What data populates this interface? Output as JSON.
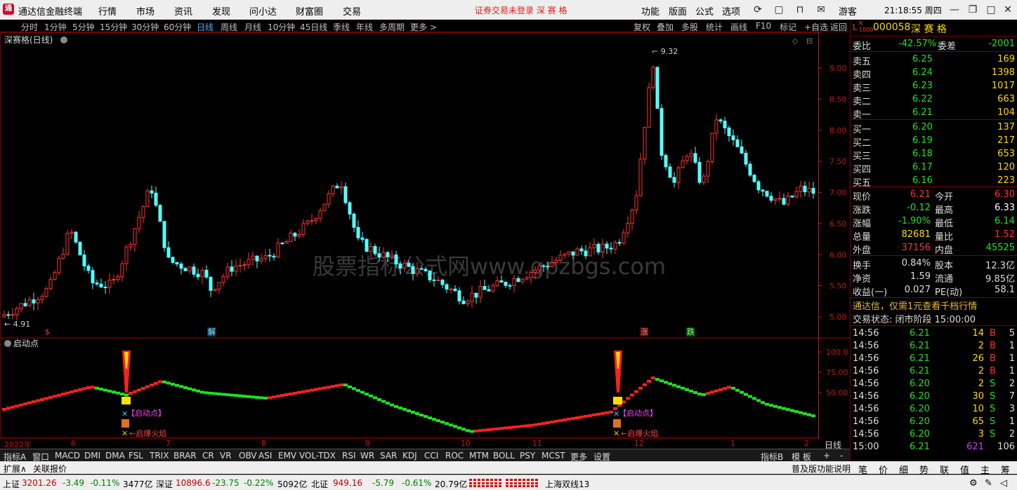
{
  "app": {
    "name": "通达信金融终端",
    "menu": [
      "行情",
      "市场",
      "资讯",
      "发现",
      "问小达",
      "财富圈",
      "交易"
    ],
    "notice": "证券交易未登录  深 赛 格",
    "right_menu": [
      "功能",
      "版面",
      "公式",
      "选项"
    ],
    "user": "游客",
    "clock": "21:18:55 周四"
  },
  "periods": [
    "分时",
    "1分钟",
    "5分钟",
    "15分钟",
    "30分钟",
    "60分钟",
    "日线",
    "周线",
    "月线",
    "10分钟",
    "45日线",
    "季线",
    "年线",
    "多周期",
    "更多 >"
  ],
  "active_period": "日线",
  "tools": [
    "复权",
    "叠加",
    "多股",
    "统计",
    "画线",
    "F10",
    "标记",
    "+自选",
    "返回"
  ],
  "chart": {
    "title": "深赛格(日线)",
    "price_labels": [
      "9.00",
      "8.50",
      "8.00",
      "7.50",
      "7.00",
      "6.50",
      "6.00",
      "5.50",
      "5.00"
    ],
    "high_marker": "9.32",
    "low_marker": "4.91",
    "watermark": "股票指标公式网www.gpzbgs.com",
    "event_tags": [
      "$",
      "解",
      "涨",
      "跌"
    ],
    "colors": {
      "up": "#ff3232",
      "down": "#54ffff",
      "axis": "#c01818"
    }
  },
  "indicator": {
    "title": "启动点",
    "levels": [
      "100.0",
      "75.00",
      "50.00"
    ],
    "signal_label": "【启动点】",
    "fire_label": "启爆火焰",
    "colors": {
      "up": "#ff2020",
      "down": "#20e020",
      "label": "#ff40ff"
    }
  },
  "xaxis": {
    "labels": [
      "2022年",
      "6",
      "7",
      "8",
      "9",
      "10",
      "11",
      "12",
      "1",
      "2"
    ],
    "period": "日线"
  },
  "quote": {
    "code": "000058",
    "name": "深 赛 格",
    "weibi_label": "委比",
    "weibi": "-42.57%",
    "weicha_label": "委差",
    "weicha": "-2001",
    "sells": [
      {
        "label": "卖五",
        "price": "6.25",
        "vol": "169"
      },
      {
        "label": "卖四",
        "price": "6.24",
        "vol": "1398"
      },
      {
        "label": "卖三",
        "price": "6.23",
        "vol": "1017"
      },
      {
        "label": "卖二",
        "price": "6.22",
        "vol": "663"
      },
      {
        "label": "卖一",
        "price": "6.21",
        "vol": "104"
      }
    ],
    "buys": [
      {
        "label": "买一",
        "price": "6.20",
        "vol": "137"
      },
      {
        "label": "买二",
        "price": "6.19",
        "vol": "217"
      },
      {
        "label": "买三",
        "price": "6.18",
        "vol": "653"
      },
      {
        "label": "买四",
        "price": "6.17",
        "vol": "120"
      },
      {
        "label": "买五",
        "price": "6.16",
        "vol": "223"
      }
    ],
    "stats": [
      {
        "l1": "现价",
        "v1": "6.21",
        "l2": "今开",
        "v2": "6.30"
      },
      {
        "l1": "涨跌",
        "v1": "-0.12",
        "l2": "最高",
        "v2": "6.33"
      },
      {
        "l1": "涨幅",
        "v1": "-1.90%",
        "l2": "最低",
        "v2": "6.14"
      },
      {
        "l1": "总量",
        "v1": "82681",
        "l2": "量比",
        "v2": "1.52"
      },
      {
        "l1": "外盘",
        "v1": "37156",
        "l2": "内盘",
        "v2": "45525"
      }
    ],
    "fund": [
      {
        "l1": "换手",
        "v1": "0.84%",
        "l2": "股本",
        "v2": "12.3亿"
      },
      {
        "l1": "净资",
        "v1": "1.59",
        "l2": "流通",
        "v2": "9.85亿"
      },
      {
        "l1": "收益(一)",
        "v1": "0.027",
        "l2": "PE(动)",
        "v2": "58.1"
      }
    ],
    "promo": "通达信，仅需1元查看千档行情",
    "trade_status": "交易状态: 闭市阶段 15:00:00",
    "ticks": [
      {
        "t": "14:56",
        "p": "6.21",
        "v": "14",
        "s": "B",
        "n": "5"
      },
      {
        "t": "14:56",
        "p": "6.21",
        "v": "2",
        "s": "B",
        "n": "1"
      },
      {
        "t": "14:56",
        "p": "6.21",
        "v": "26",
        "s": "B",
        "n": "1"
      },
      {
        "t": "14:56",
        "p": "6.21",
        "v": "2",
        "s": "B",
        "n": "1"
      },
      {
        "t": "14:56",
        "p": "6.20",
        "v": "2",
        "s": "S",
        "n": "2"
      },
      {
        "t": "14:56",
        "p": "6.20",
        "v": "30",
        "s": "S",
        "n": "7"
      },
      {
        "t": "14:56",
        "p": "6.20",
        "v": "10",
        "s": "S",
        "n": "3"
      },
      {
        "t": "14:56",
        "p": "6.20",
        "v": "65",
        "s": "S",
        "n": "1"
      },
      {
        "t": "14:56",
        "p": "6.20",
        "v": "3",
        "s": "S",
        "n": "2"
      },
      {
        "t": "15:00",
        "p": "6.21",
        "v": "621",
        "s": "",
        "n": "106"
      }
    ]
  },
  "bottom_tabs": [
    "指标A",
    "窗口",
    "MACD",
    "DMI",
    "DMA",
    "FSL",
    "TRIX",
    "BRAR",
    "CR",
    "VR",
    "OBV",
    "ASI",
    "EMV",
    "VOL-TDX",
    "RSI",
    "WR",
    "SAR",
    "KDJ",
    "CCI",
    "ROC",
    "MTM",
    "BOLL",
    "PSY",
    "MCST",
    "更多",
    "设置"
  ],
  "bottom_right": [
    "指标B",
    "模 板",
    "+",
    "-"
  ],
  "extend": [
    "扩展∧",
    "关联报价"
  ],
  "ext_right": "普及版功能说明",
  "right_tabs": [
    "笔",
    "价",
    "细",
    "势",
    "联",
    "值",
    "主",
    "筹"
  ],
  "status": {
    "sh_label": "上证",
    "sh": "3201.26",
    "sh_chg": "-3.49",
    "sh_pct": "-0.11%",
    "sh_amt": "3477亿",
    "sz_label": "深证",
    "sz": "10896.6",
    "sz_chg": "-23.75",
    "sz_pct": "-0.22%",
    "sz_amt": "5092亿",
    "bz_label": "北证",
    "bz": "949.16",
    "bz_chg": "-5.79",
    "bz_pct": "-0.61%",
    "bz_amt": "20.79亿",
    "line": "上海双线13"
  }
}
